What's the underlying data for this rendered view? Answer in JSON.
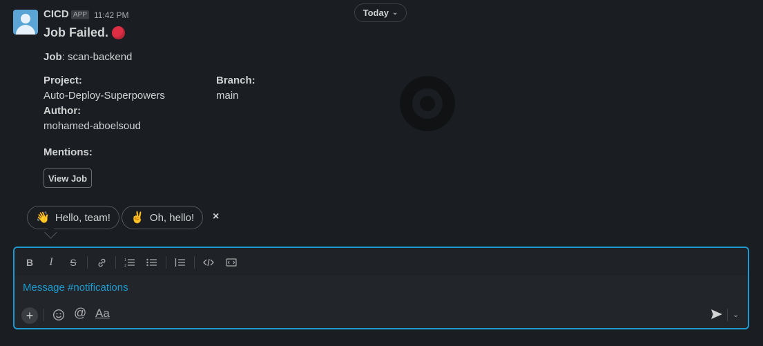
{
  "date_divider": {
    "label": "Today"
  },
  "message": {
    "sender": "CICD",
    "app_badge": "APP",
    "timestamp": "11:42 PM",
    "title": "Job Failed.",
    "job_label": "Job",
    "job_value": ": scan-backend",
    "project_label": "Project:",
    "project_value": "Auto-Deploy-Superpowers",
    "branch_label": "Branch:",
    "branch_value": "main",
    "author_label": "Author:",
    "author_value": "mohamed-aboelsoud",
    "mentions_label": "Mentions:",
    "view_job_button": "View Job"
  },
  "quick_replies": [
    {
      "emoji": "👋",
      "label": "Hello, team!"
    },
    {
      "emoji": "✌",
      "label": "Oh, hello!"
    }
  ],
  "quick_replies_close": "×",
  "composer": {
    "placeholder": "Message #notifications",
    "format_label": "Aa"
  },
  "colors": {
    "accent": "#1d9bd1",
    "background": "#1a1d21",
    "status_failed": "#dd2e44"
  }
}
